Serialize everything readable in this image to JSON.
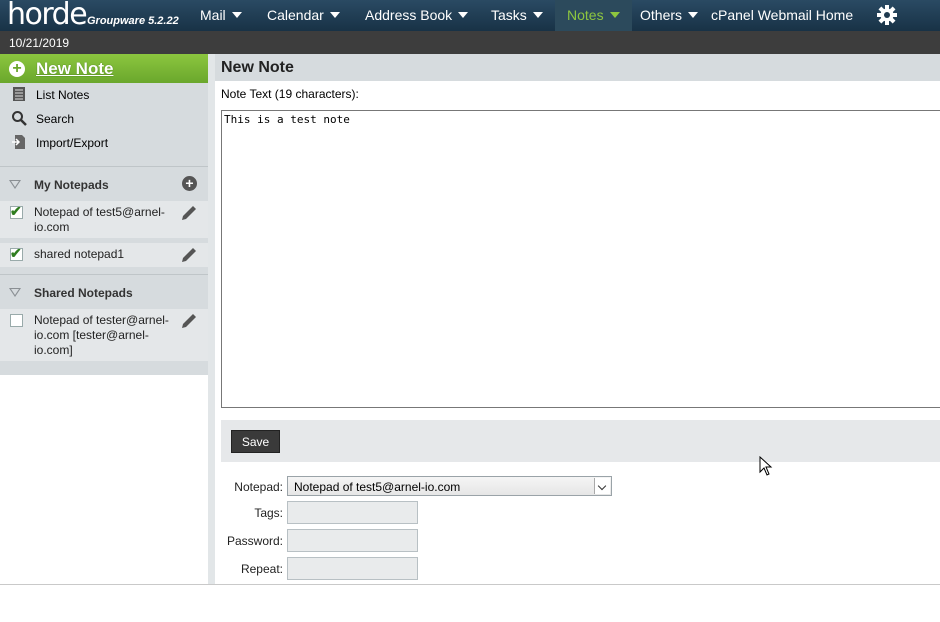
{
  "header": {
    "logo": "horde",
    "product": "Groupware 5.2.22",
    "menus": [
      {
        "label": "Mail",
        "has_dropdown": true
      },
      {
        "label": "Calendar",
        "has_dropdown": true
      },
      {
        "label": "Address Book",
        "has_dropdown": true
      },
      {
        "label": "Tasks",
        "has_dropdown": true
      },
      {
        "label": "Notes",
        "has_dropdown": true,
        "active": true
      },
      {
        "label": "Others",
        "has_dropdown": true
      },
      {
        "label": "cPanel Webmail Home",
        "has_dropdown": false
      }
    ],
    "settings_icon": "gear-icon"
  },
  "datebar": {
    "date": "10/21/2019"
  },
  "sidebar": {
    "new_note": "New Note",
    "nav": [
      {
        "label": "List Notes",
        "icon": "list-icon"
      },
      {
        "label": "Search",
        "icon": "search-icon"
      },
      {
        "label": "Import/Export",
        "icon": "import-export-icon"
      }
    ],
    "my_notepads": {
      "title": "My Notepads",
      "items": [
        {
          "label": "Notepad of test5@arnel-io.com",
          "checked": true
        },
        {
          "label": "shared notepad1",
          "checked": true
        }
      ]
    },
    "shared_notepads": {
      "title": "Shared Notepads",
      "items": [
        {
          "label": "Notepad of tester@arnel-io.com [tester@arnel-io.com]",
          "checked": false
        }
      ]
    }
  },
  "main": {
    "title": "New Note",
    "note_label": "Note Text (19 characters):",
    "note_text": "This is a test note",
    "save_label": "Save",
    "form": {
      "notepad_label": "Notepad:",
      "notepad_value": "Notepad of test5@arnel-io.com",
      "tags_label": "Tags:",
      "password_label": "Password:",
      "repeat_label": "Repeat:"
    }
  },
  "colors": {
    "topbar": "#1f3a4f",
    "active_menu": "#8ec63f",
    "new_note_bg": "#7ab535",
    "sidebar_section": "#d6dbde"
  }
}
